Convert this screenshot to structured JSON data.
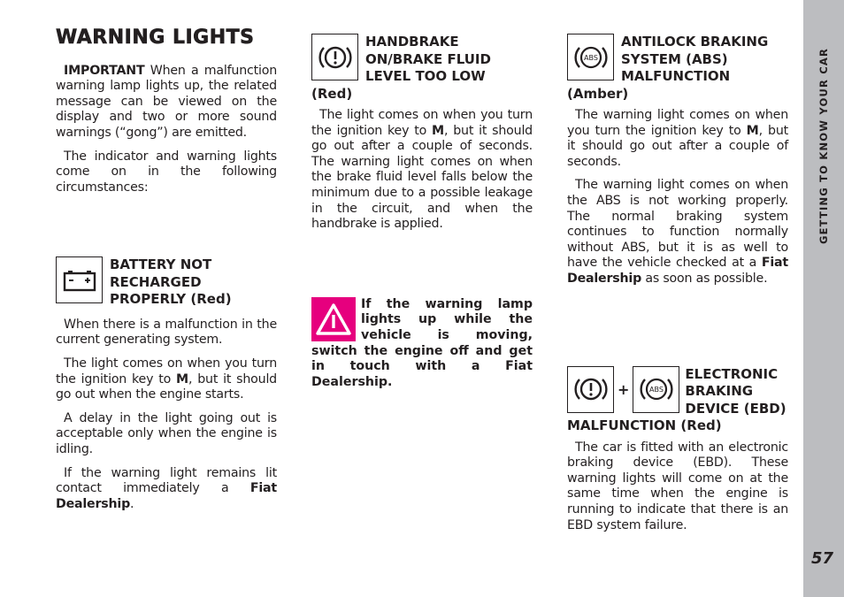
{
  "page": {
    "title": "WARNING LIGHTS",
    "section": "GETTING TO KNOW YOUR CAR",
    "page_number": "57"
  },
  "intro": {
    "important_label": "IMPORTANT",
    "p1": " When a malfunction warning lamp lights up, the related message can be viewed on the display and two or more sound warnings (“gong”) are emitted.",
    "p2": "The indicator and warning lights come on in the following circumstances:"
  },
  "battery": {
    "icon": "battery-icon",
    "title": "BATTERY NOT RECHARGED PROPERLY (Red)",
    "p1": "When there is a malfunction in the current generating system.",
    "p2_a": "The light comes on when you turn the ignition key to ",
    "p2_key": "M",
    "p2_b": ", but it should go out when the engine starts.",
    "p3": "A delay in the light going out is acceptable only when the engine is idling.",
    "p4_a": "If the warning light remains lit contact immediately a ",
    "p4_dealer": "Fiat Dealership",
    "p4_b": "."
  },
  "handbrake": {
    "icon": "brake-warning-icon",
    "title": "HANDBRAKE ON/BRAKE FLUID LEVEL TOO LOW",
    "color_label": "(Red)",
    "p1_a": "The light comes on when you turn the ignition key to ",
    "p1_key": "M",
    "p1_b": ", but it should go out after a couple of seconds. The warning light comes on when the brake fluid level falls below the minimum due to a possible leakage in the circuit, and when the handbrake is applied."
  },
  "warning_note": {
    "icon": "warning-triangle-icon",
    "text": "If the warning lamp lights up while the vehicle is moving, switch the engine off and get in touch with a Fiat Dealership.",
    "accent_color": "#e6007e"
  },
  "abs": {
    "icon": "abs-icon",
    "title": "ANTILOCK BRAKING SYSTEM (ABS) MALFUNCTION",
    "color_label": "(Amber)",
    "p1_a": "The warning light comes on when you turn the ignition key to ",
    "p1_key": "M",
    "p1_b": ", but it should go out after a couple of seconds.",
    "p2_a": "The warning light comes on when the ABS is not working properly. The normal braking system continues to function normally without ABS, but it is as well to have the vehicle checked at a ",
    "p2_dealer": "Fiat Dealership",
    "p2_b": " as soon as possible."
  },
  "ebd": {
    "icons": [
      "brake-warning-icon",
      "abs-icon"
    ],
    "plus": "+",
    "title": "ELECTRONIC BRAKING DEVICE (EBD)",
    "title_cont": "MALFUNCTION (Red)",
    "p1": "The car is fitted with an electronic braking device (EBD). These warning lights will come on at the same time when the engine is running to indicate that there is an EBD system failure."
  },
  "colors": {
    "sidebar": "#bcbdc0",
    "text": "#231f20",
    "warning_magenta": "#e6007e"
  }
}
